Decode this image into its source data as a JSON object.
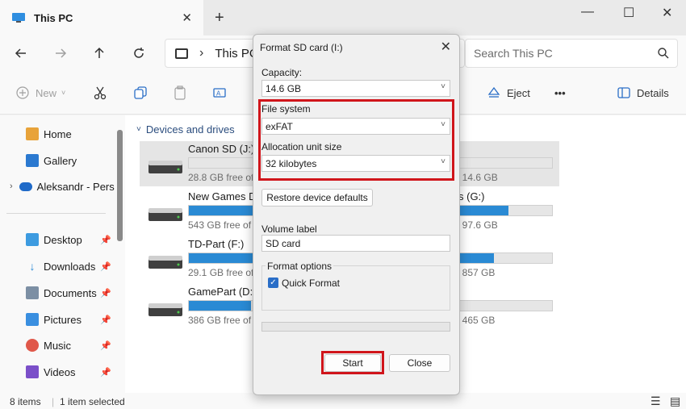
{
  "window": {
    "tab_title": "This PC",
    "new_tab_label": "+",
    "minimize": "—",
    "maximize": "☐",
    "close": "✕",
    "tab_close": "✕"
  },
  "address": {
    "path": "This PC",
    "search_placeholder": "Search This PC"
  },
  "toolbar": {
    "new_label": "New",
    "eject_label": "Eject",
    "more_label": "•••",
    "details_label": "Details"
  },
  "sidebar": {
    "items": [
      {
        "label": "Home",
        "color": "#e8a33a"
      },
      {
        "label": "Gallery",
        "color": "#2b79d0"
      },
      {
        "label": "Aleksandr - Pers",
        "color": "#1f6ac8"
      },
      {
        "label": "Desktop",
        "color": "#3d9be0"
      },
      {
        "label": "Downloads",
        "color": "#2a8ad4"
      },
      {
        "label": "Documents",
        "color": "#7c8fa4"
      },
      {
        "label": "Pictures",
        "color": "#3a8fe0"
      },
      {
        "label": "Music",
        "color": "#e0584a"
      },
      {
        "label": "Videos",
        "color": "#7b4fc9"
      }
    ]
  },
  "content": {
    "section_title": "Devices and drives",
    "drives": [
      {
        "name": "Canon SD (J:)",
        "free": "28.8 GB free of",
        "total": "f 14.6 GB",
        "used_fraction": 0.0
      },
      {
        "name": "New Games Dri",
        "free": "543 GB free of",
        "total": "f 97.6 GB",
        "used_fraction": 0.88,
        "name_tail": "s (G:)"
      },
      {
        "name": "TD-Part (F:)",
        "free": "29.1 GB free of",
        "total": "f 857 GB",
        "used_fraction": 0.84
      },
      {
        "name": "GamePart (D:)",
        "free": "386 GB free of",
        "total": "f 465 GB",
        "used_fraction": 0.17
      }
    ]
  },
  "status": {
    "items_count": "8 items",
    "selected": "1 item selected"
  },
  "dialog": {
    "title": "Format SD card (I:)",
    "capacity_label": "Capacity:",
    "capacity_value": "14.6 GB",
    "file_system_label": "File system",
    "file_system_value": "exFAT",
    "allocation_label": "Allocation unit size",
    "allocation_value": "32 kilobytes",
    "restore_label": "Restore device defaults",
    "volume_label_label": "Volume label",
    "volume_label_value": "SD card",
    "format_options_label": "Format options",
    "quick_format_label": "Quick Format",
    "quick_format_checked": true,
    "start_label": "Start",
    "close_label": "Close",
    "highlight_color": "#d0151b"
  }
}
